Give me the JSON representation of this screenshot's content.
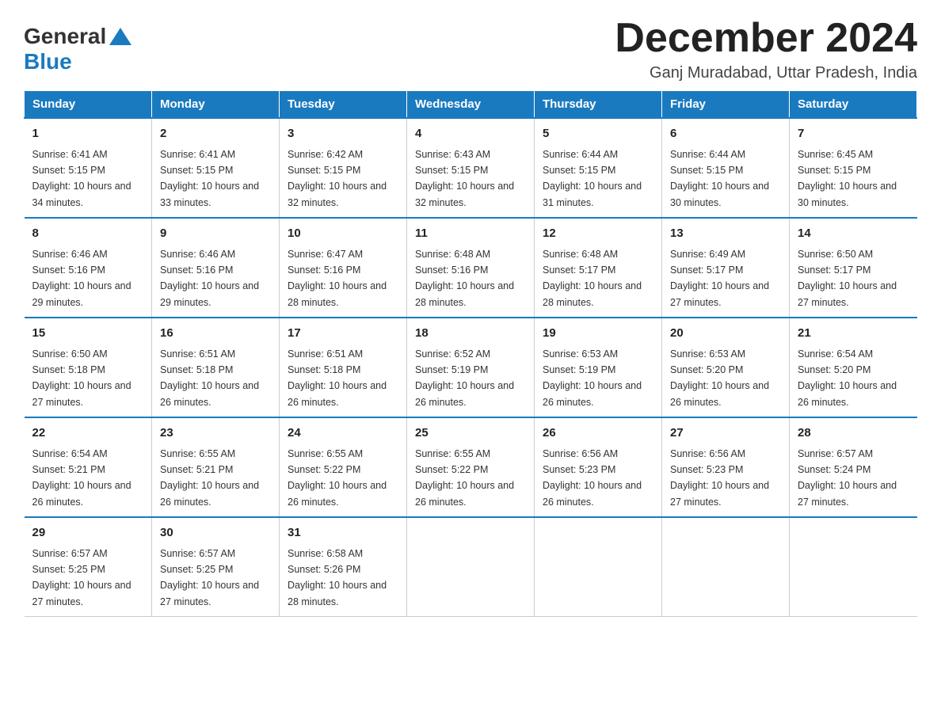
{
  "header": {
    "title": "December 2024",
    "location": "Ganj Muradabad, Uttar Pradesh, India",
    "logo_general": "General",
    "logo_blue": "Blue"
  },
  "days_of_week": [
    "Sunday",
    "Monday",
    "Tuesday",
    "Wednesday",
    "Thursday",
    "Friday",
    "Saturday"
  ],
  "weeks": [
    [
      {
        "day": "1",
        "sunrise": "6:41 AM",
        "sunset": "5:15 PM",
        "daylight": "10 hours and 34 minutes."
      },
      {
        "day": "2",
        "sunrise": "6:41 AM",
        "sunset": "5:15 PM",
        "daylight": "10 hours and 33 minutes."
      },
      {
        "day": "3",
        "sunrise": "6:42 AM",
        "sunset": "5:15 PM",
        "daylight": "10 hours and 32 minutes."
      },
      {
        "day": "4",
        "sunrise": "6:43 AM",
        "sunset": "5:15 PM",
        "daylight": "10 hours and 32 minutes."
      },
      {
        "day": "5",
        "sunrise": "6:44 AM",
        "sunset": "5:15 PM",
        "daylight": "10 hours and 31 minutes."
      },
      {
        "day": "6",
        "sunrise": "6:44 AM",
        "sunset": "5:15 PM",
        "daylight": "10 hours and 30 minutes."
      },
      {
        "day": "7",
        "sunrise": "6:45 AM",
        "sunset": "5:15 PM",
        "daylight": "10 hours and 30 minutes."
      }
    ],
    [
      {
        "day": "8",
        "sunrise": "6:46 AM",
        "sunset": "5:16 PM",
        "daylight": "10 hours and 29 minutes."
      },
      {
        "day": "9",
        "sunrise": "6:46 AM",
        "sunset": "5:16 PM",
        "daylight": "10 hours and 29 minutes."
      },
      {
        "day": "10",
        "sunrise": "6:47 AM",
        "sunset": "5:16 PM",
        "daylight": "10 hours and 28 minutes."
      },
      {
        "day": "11",
        "sunrise": "6:48 AM",
        "sunset": "5:16 PM",
        "daylight": "10 hours and 28 minutes."
      },
      {
        "day": "12",
        "sunrise": "6:48 AM",
        "sunset": "5:17 PM",
        "daylight": "10 hours and 28 minutes."
      },
      {
        "day": "13",
        "sunrise": "6:49 AM",
        "sunset": "5:17 PM",
        "daylight": "10 hours and 27 minutes."
      },
      {
        "day": "14",
        "sunrise": "6:50 AM",
        "sunset": "5:17 PM",
        "daylight": "10 hours and 27 minutes."
      }
    ],
    [
      {
        "day": "15",
        "sunrise": "6:50 AM",
        "sunset": "5:18 PM",
        "daylight": "10 hours and 27 minutes."
      },
      {
        "day": "16",
        "sunrise": "6:51 AM",
        "sunset": "5:18 PM",
        "daylight": "10 hours and 26 minutes."
      },
      {
        "day": "17",
        "sunrise": "6:51 AM",
        "sunset": "5:18 PM",
        "daylight": "10 hours and 26 minutes."
      },
      {
        "day": "18",
        "sunrise": "6:52 AM",
        "sunset": "5:19 PM",
        "daylight": "10 hours and 26 minutes."
      },
      {
        "day": "19",
        "sunrise": "6:53 AM",
        "sunset": "5:19 PM",
        "daylight": "10 hours and 26 minutes."
      },
      {
        "day": "20",
        "sunrise": "6:53 AM",
        "sunset": "5:20 PM",
        "daylight": "10 hours and 26 minutes."
      },
      {
        "day": "21",
        "sunrise": "6:54 AM",
        "sunset": "5:20 PM",
        "daylight": "10 hours and 26 minutes."
      }
    ],
    [
      {
        "day": "22",
        "sunrise": "6:54 AM",
        "sunset": "5:21 PM",
        "daylight": "10 hours and 26 minutes."
      },
      {
        "day": "23",
        "sunrise": "6:55 AM",
        "sunset": "5:21 PM",
        "daylight": "10 hours and 26 minutes."
      },
      {
        "day": "24",
        "sunrise": "6:55 AM",
        "sunset": "5:22 PM",
        "daylight": "10 hours and 26 minutes."
      },
      {
        "day": "25",
        "sunrise": "6:55 AM",
        "sunset": "5:22 PM",
        "daylight": "10 hours and 26 minutes."
      },
      {
        "day": "26",
        "sunrise": "6:56 AM",
        "sunset": "5:23 PM",
        "daylight": "10 hours and 26 minutes."
      },
      {
        "day": "27",
        "sunrise": "6:56 AM",
        "sunset": "5:23 PM",
        "daylight": "10 hours and 27 minutes."
      },
      {
        "day": "28",
        "sunrise": "6:57 AM",
        "sunset": "5:24 PM",
        "daylight": "10 hours and 27 minutes."
      }
    ],
    [
      {
        "day": "29",
        "sunrise": "6:57 AM",
        "sunset": "5:25 PM",
        "daylight": "10 hours and 27 minutes."
      },
      {
        "day": "30",
        "sunrise": "6:57 AM",
        "sunset": "5:25 PM",
        "daylight": "10 hours and 27 minutes."
      },
      {
        "day": "31",
        "sunrise": "6:58 AM",
        "sunset": "5:26 PM",
        "daylight": "10 hours and 28 minutes."
      },
      null,
      null,
      null,
      null
    ]
  ]
}
